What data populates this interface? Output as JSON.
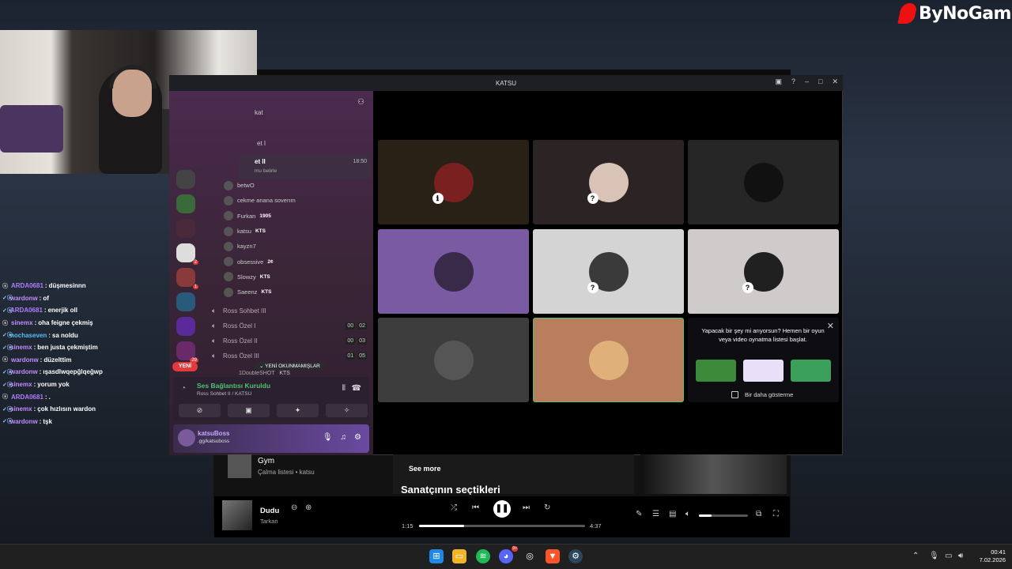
{
  "watermark": {
    "text": "ByNoGame"
  },
  "chat": {
    "lines": [
      {
        "user": "ARDA0681",
        "msg": "düşmesinnn",
        "color": "#b07cff"
      },
      {
        "user": "wardonw",
        "msg": "of",
        "color": "#c38cff"
      },
      {
        "user": "ARDA0681",
        "msg": "enerjik oll",
        "color": "#b07cff"
      },
      {
        "user": "sinemx",
        "msg": "oha feigne çekmiş",
        "color": "#c38cff"
      },
      {
        "user": "nochaseven",
        "msg": "sa noldu",
        "color": "#4fc3f7"
      },
      {
        "user": "sinemx",
        "msg": "ben justa çekmiştim",
        "color": "#c38cff"
      },
      {
        "user": "wardonw",
        "msg": "düzelttim",
        "color": "#c38cff"
      },
      {
        "user": "wardonw",
        "msg": "ışasdlwqepğlqeğwp",
        "color": "#c38cff"
      },
      {
        "user": "sinemx",
        "msg": "yorum yok",
        "color": "#c38cff"
      },
      {
        "user": "ARDA0681",
        "msg": ".",
        "color": "#b07cff"
      },
      {
        "user": "sinemx",
        "msg": "çok hızlısın wardon",
        "color": "#c38cff"
      },
      {
        "user": "wardonw",
        "msg": "tşk",
        "color": "#c38cff"
      }
    ]
  },
  "discord": {
    "title": "KATSU",
    "top_channels": [
      "kat",
      "et I",
      "et II"
    ],
    "selected_time": "18:50",
    "selected_sub": "mu belirle",
    "members": [
      {
        "name": "betwO",
        "tag": ""
      },
      {
        "name": "cekme anana soverım",
        "tag": ""
      },
      {
        "name": "Furkan",
        "tag": "1905"
      },
      {
        "name": "katsu",
        "tag": "KTS"
      },
      {
        "name": "kayzn7",
        "tag": ""
      },
      {
        "name": "obsessive",
        "tag": "2¢"
      },
      {
        "name": "Slowzy",
        "tag": "KTS"
      },
      {
        "name": "Saeenz",
        "tag": "KTS"
      }
    ],
    "voice_channels": [
      {
        "name": "Ross Sohbet III",
        "a": "",
        "b": ""
      },
      {
        "name": "Ross Özel I",
        "a": "00",
        "b": "02"
      },
      {
        "name": "Ross Özel II",
        "a": "00",
        "b": "03"
      },
      {
        "name": "Ross Özel III",
        "a": "01",
        "b": "05"
      }
    ],
    "unread_label": "YENİ OKUNMAMIŞLAR",
    "new_badge": "YENİ",
    "peek_channel": "1DoubleSHOT",
    "peek_tag": "KTS",
    "server_badges": [
      "2",
      "1",
      "29"
    ],
    "voice": {
      "status": "Ses Bağlantısı Kuruldu",
      "sub": "Ross Sohbet II / KATSU"
    },
    "user": {
      "name": "katsuBoss",
      "status": ".gg/katsuboss"
    },
    "tiles": [
      {
        "bg": "#2a2116",
        "av": "#7a2020"
      },
      {
        "bg": "#2c2424",
        "av": "#d9c2b6"
      },
      {
        "bg": "#262626",
        "av": "#111111"
      },
      {
        "bg": "#7a5aa3",
        "av": "#3a2a4a"
      },
      {
        "bg": "#d4d4d4",
        "av": "#3a3a3a"
      },
      {
        "bg": "#d0cbcb",
        "av": "#202020"
      },
      {
        "bg": "#3d3d3d",
        "av": "#555555"
      },
      {
        "bg": "#b97e5e",
        "av": "#e0b07a"
      }
    ],
    "promo": {
      "text": "Yapacak bir şey mi arıyorsun? Hemen bir oyun veya video oynatma listesi başlat.",
      "checkbox": "Bir daha gösterme"
    }
  },
  "music": {
    "playlist": {
      "title": "Gym",
      "sub": "Çalma listesi • katsu"
    },
    "see_more": "See more",
    "section": "Sanatçının seçtikleri",
    "song": "Dudu",
    "artist": "Tarkan",
    "elapsed": "1:15",
    "duration": "4:37",
    "progress": 0.27,
    "volume": 0.26
  },
  "taskbar": {
    "time": "00:41",
    "date": "7.02.2026",
    "discord_badge": "9+"
  }
}
